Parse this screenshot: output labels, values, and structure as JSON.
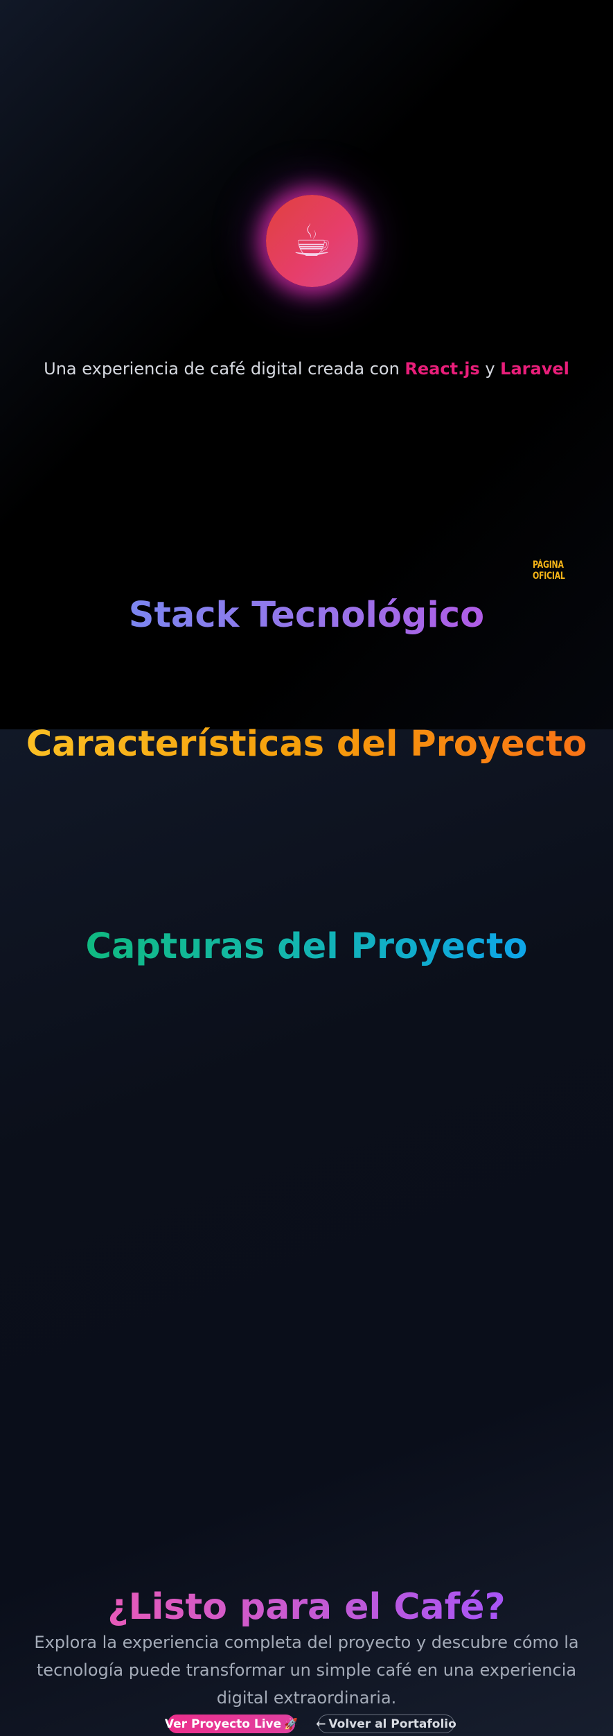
{
  "hero": {
    "icon": "☕",
    "icon_name": "coffee-cup-icon",
    "tagline_prefix": "Una experiencia de café digital creada con ",
    "tech_1": "React.js",
    "tagline_joiner": " y ",
    "tech_2": "Laravel",
    "badge": "PÁGINA OFICIAL"
  },
  "sections": {
    "stack_title": "Stack Tecnológico",
    "features_title": "Características del Proyecto",
    "screenshots_title": "Capturas del Proyecto"
  },
  "cta": {
    "title": "¿Listo para el Café?",
    "description": "Explora la experiencia completa del proyecto y descubre cómo la tecnología puede transformar un simple café en una experiencia digital extraordinaria.",
    "live_button": "Ver Proyecto Live",
    "live_icon": "🚀",
    "back_arrow": "←",
    "back_button": "Volver al Portafolio"
  },
  "colors": {
    "accent_pink": "#e91e7a",
    "badge_yellow": "#f5b417"
  }
}
